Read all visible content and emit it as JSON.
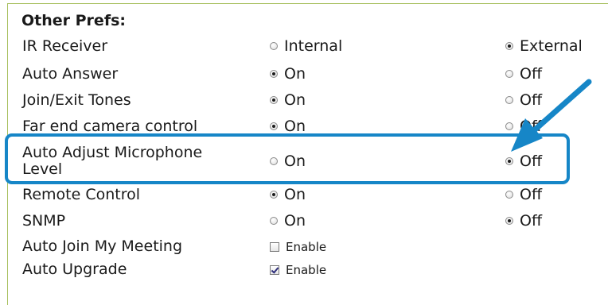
{
  "section": {
    "title": "Other Prefs:"
  },
  "rows": [
    {
      "label": "IR Receiver",
      "opt1": "Internal",
      "opt2": "External",
      "selected": 2
    },
    {
      "label": "Auto Answer",
      "opt1": "On",
      "opt2": "Off",
      "selected": 1
    },
    {
      "label": "Join/Exit Tones",
      "opt1": "On",
      "opt2": "Off",
      "selected": 1
    },
    {
      "label": "Far end camera control",
      "opt1": "On",
      "opt2": "Off",
      "selected": 1
    },
    {
      "label_line1": "Auto Adjust Microphone",
      "label_line2": "Level",
      "opt1": "On",
      "opt2": "Off",
      "selected": 2
    },
    {
      "label": "Remote Control",
      "opt1": "On",
      "opt2": "Off",
      "selected": 1
    },
    {
      "label": "SNMP",
      "opt1": "On",
      "opt2": "Off",
      "selected": 2
    }
  ],
  "checks": [
    {
      "label": "Auto Join My Meeting",
      "option": "Enable",
      "checked": false
    },
    {
      "label": "Auto Upgrade",
      "option": "Enable",
      "checked": true
    }
  ],
  "colors": {
    "highlight": "#1686c7",
    "panel_border": "#a8c060"
  },
  "icons": {
    "annotation": "arrow-pointer-icon"
  }
}
